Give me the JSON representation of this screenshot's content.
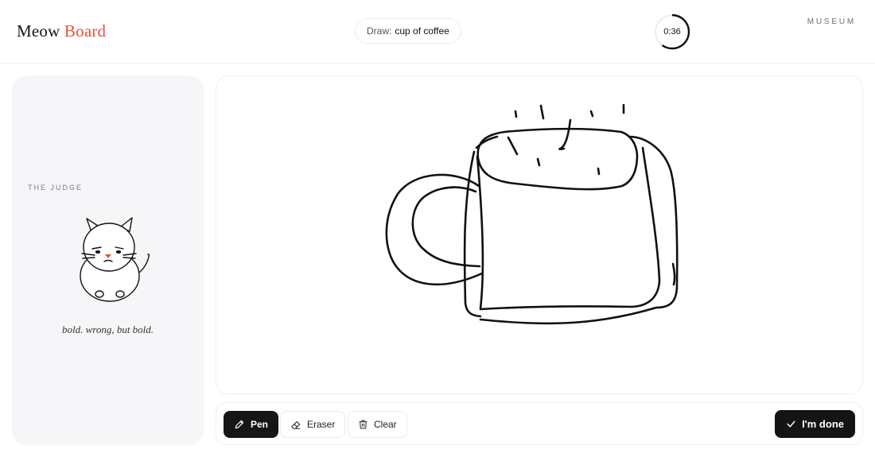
{
  "header": {
    "logo_word_1": "Meow",
    "logo_word_2": "Board",
    "prompt_label": "Draw:",
    "prompt_word": "cup of coffee",
    "timer": "0:36",
    "timer_progress": 0.6,
    "museum_label": "MUSEUM"
  },
  "judge": {
    "label": "THE JUDGE",
    "quote": "bold. wrong, but bold."
  },
  "toolbar": {
    "pen_label": "Pen",
    "eraser_label": "Eraser",
    "clear_label": "Clear",
    "done_label": "I'm done",
    "active_tool": "pen"
  },
  "icons": {
    "pen": "pencil-icon",
    "eraser": "eraser-icon",
    "clear": "trash-icon",
    "done": "check-icon"
  },
  "colors": {
    "accent": "#e8503a",
    "dark": "#141414",
    "panel": "#f6f5f8"
  }
}
